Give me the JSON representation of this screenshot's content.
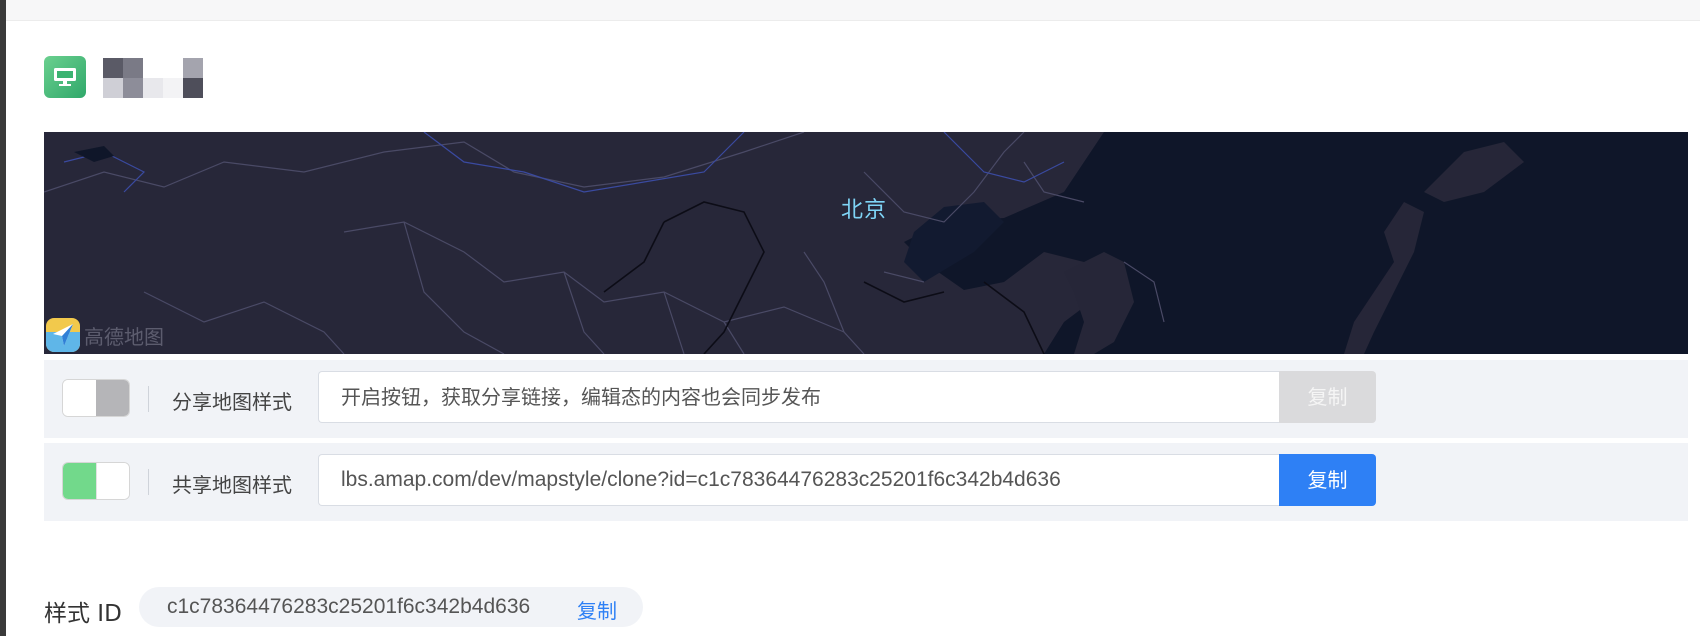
{
  "header": {
    "icon": "desktop-monitor-icon",
    "style_name_masked": true
  },
  "map": {
    "city_label": "北京",
    "logo_text": "高德地图",
    "theme_colors": {
      "land": "#272739",
      "sea": "#0f1629",
      "borders": "#4a4a66",
      "label": "#7fd4f6"
    }
  },
  "share_rows": [
    {
      "enabled": false,
      "label": "分享地图样式",
      "input_value": "开启按钮，获取分享链接，编辑态的内容也会同步发布",
      "copy_label": "复制"
    },
    {
      "enabled": true,
      "label": "共享地图样式",
      "input_value": "lbs.amap.com/dev/mapstyle/clone?id=c1c78364476283c25201f6c342b4d636",
      "copy_label": "复制"
    }
  ],
  "style_id": {
    "label": "样式 ID",
    "value": "c1c78364476283c25201f6c342b4d636",
    "copy_label": "复制"
  },
  "colors": {
    "accent": "#2e80f5",
    "toggle_on": "#72d98b",
    "disabled": "#dadadc"
  }
}
